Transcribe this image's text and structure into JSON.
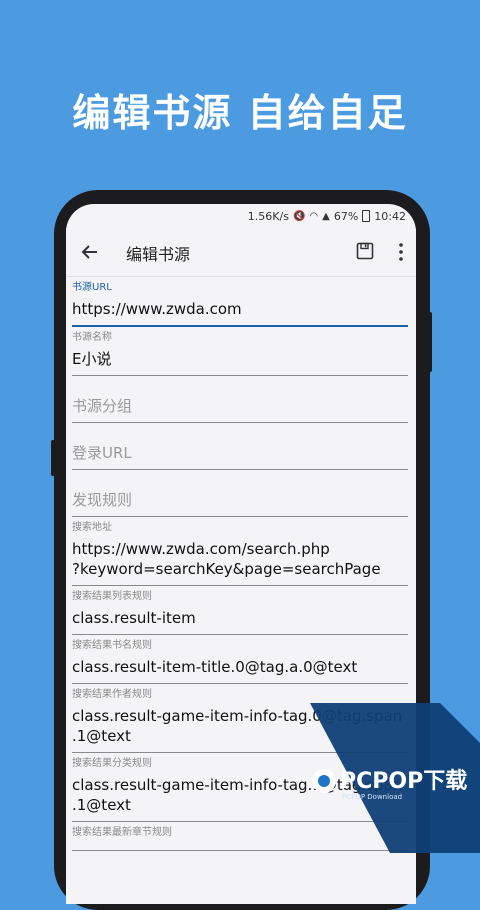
{
  "headline": "编辑书源  自给自足",
  "status": {
    "speed": "1.56K/s",
    "battery": "67%",
    "time": "10:42"
  },
  "appbar": {
    "title": "编辑书源"
  },
  "fields": [
    {
      "label": "书源URL",
      "value": "https://www.zwda.com",
      "focused": true
    },
    {
      "label": "书源名称",
      "value": "E小说"
    },
    {
      "label": "",
      "value": "书源分组",
      "placeholder": true
    },
    {
      "label": "",
      "value": "登录URL",
      "placeholder": true
    },
    {
      "label": "",
      "value": "发现规则",
      "placeholder": true
    },
    {
      "label": "搜索地址",
      "value": "https://www.zwda.com/search.php\n?keyword=searchKey&page=searchPage"
    },
    {
      "label": "搜索结果列表规则",
      "value": "class.result-item"
    },
    {
      "label": "搜索结果书名规则",
      "value": "class.result-item-title.0@tag.a.0@text"
    },
    {
      "label": "搜索结果作者规则",
      "value": "class.result-game-item-info-tag.0@tag.span\n.1@text"
    },
    {
      "label": "搜索结果分类规则",
      "value": "class.result-game-item-info-tag.1@tag.span\n.1@text"
    },
    {
      "label": "搜索结果最新章节规则",
      "value": ""
    }
  ],
  "watermark": {
    "brand": "PCPOP下载",
    "sub": "PCPOP Download"
  }
}
